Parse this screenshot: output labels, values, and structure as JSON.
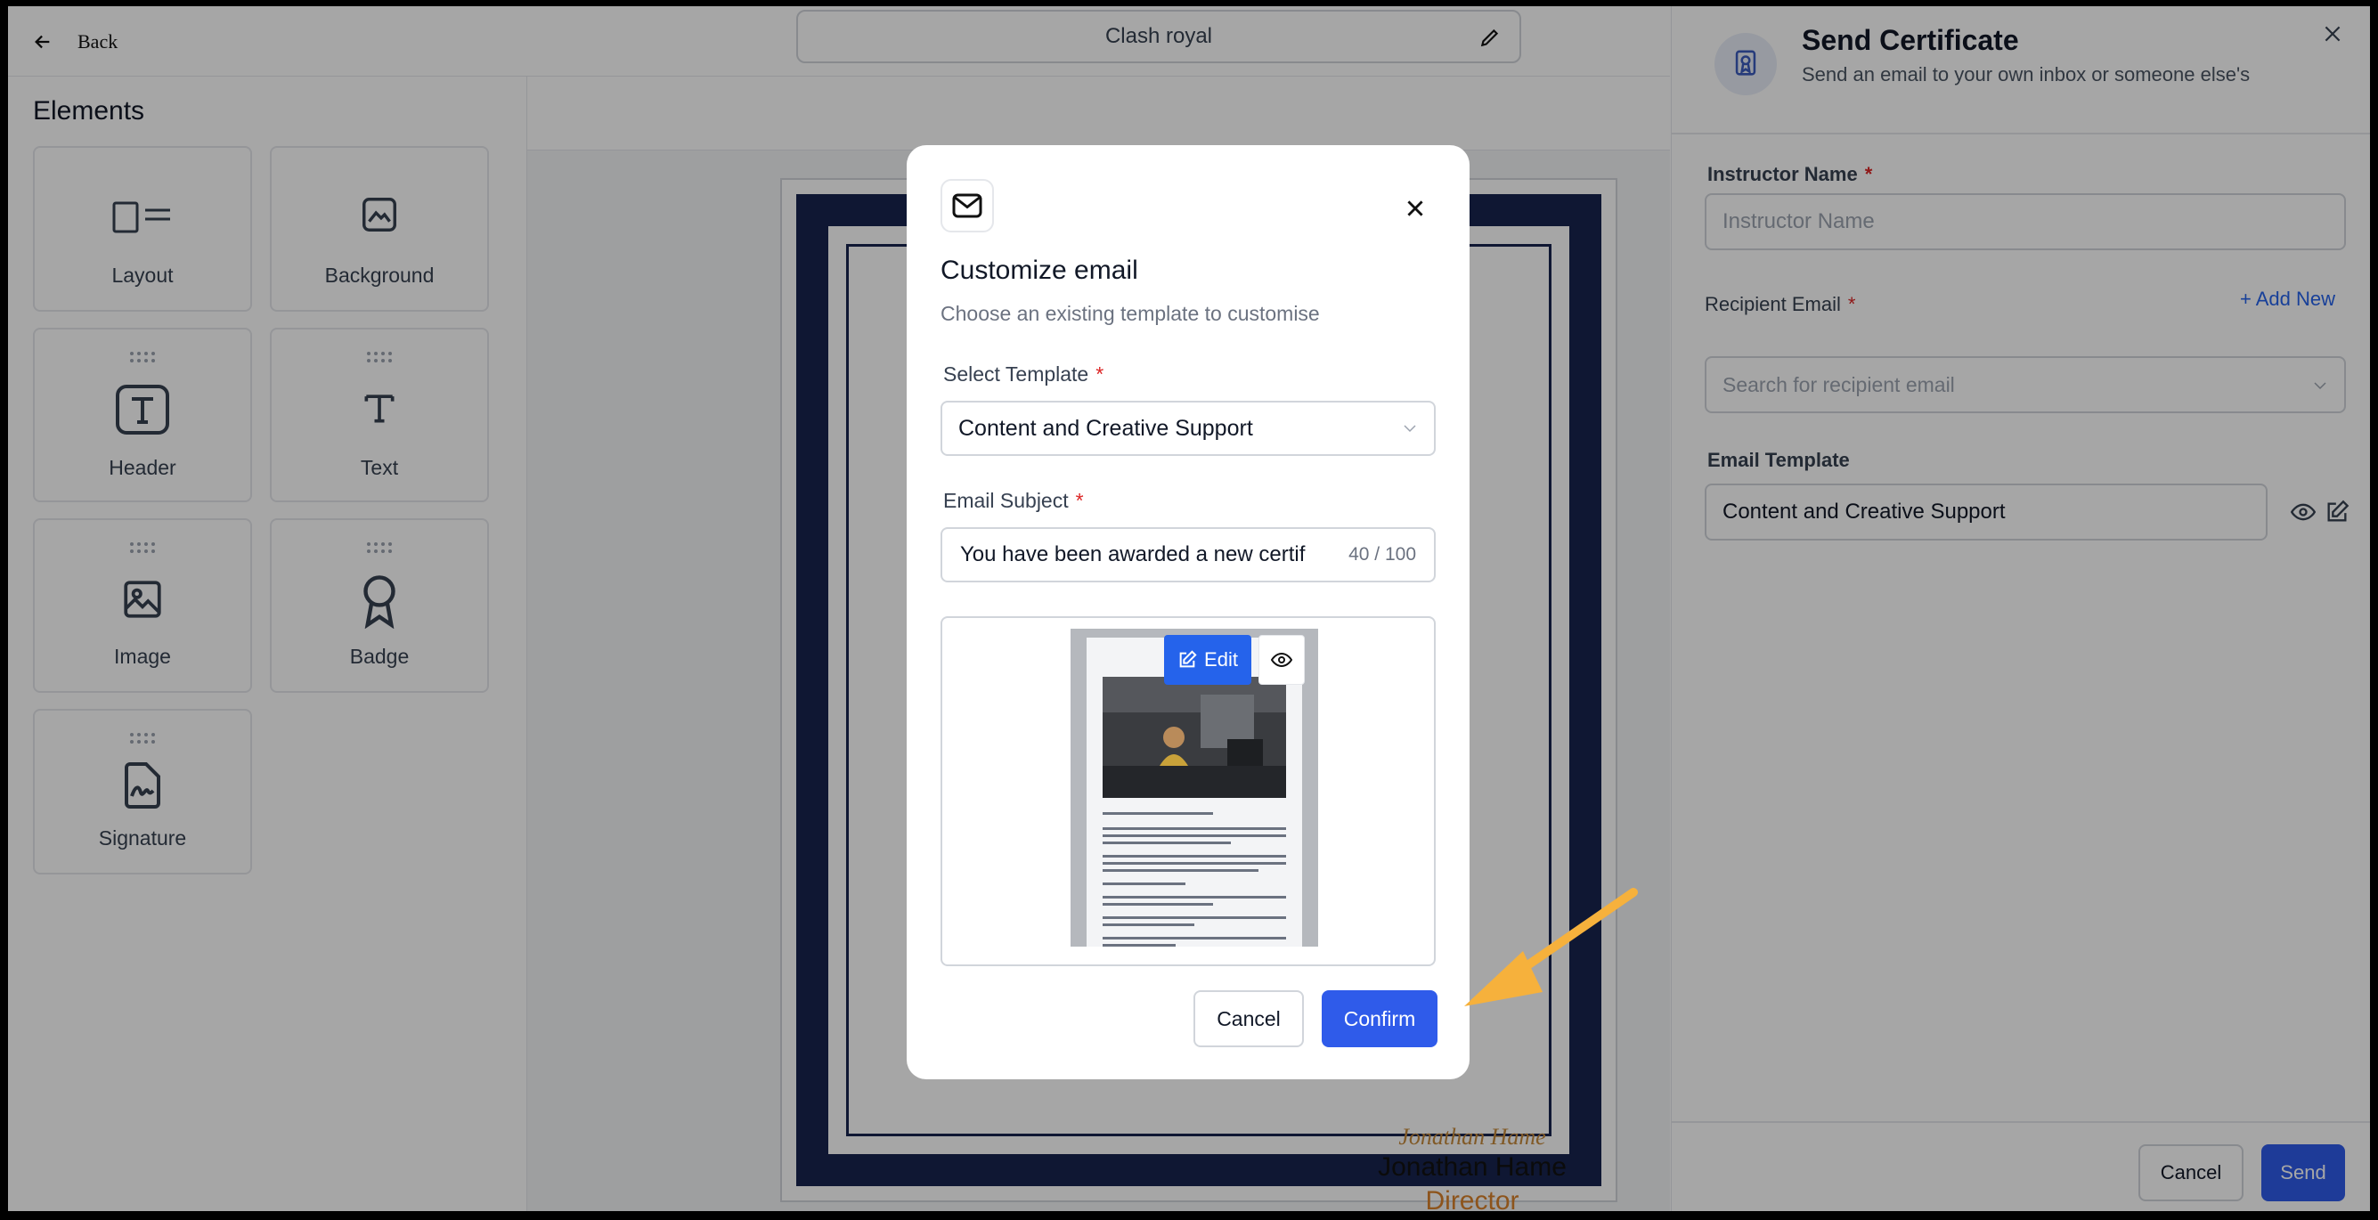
{
  "topbar": {
    "back_label": "Back",
    "document_title": "Clash royal"
  },
  "sidebar": {
    "heading": "Elements",
    "items": [
      {
        "label": "Layout",
        "icon": "layout-icon"
      },
      {
        "label": "Background",
        "icon": "image-frame-icon"
      },
      {
        "label": "Header",
        "icon": "header-t-icon"
      },
      {
        "label": "Text",
        "icon": "text-t-icon"
      },
      {
        "label": "Image",
        "icon": "image-icon"
      },
      {
        "label": "Badge",
        "icon": "badge-icon"
      },
      {
        "label": "Signature",
        "icon": "signature-icon"
      }
    ]
  },
  "certificate": {
    "signature_text": "Jonathan Hame",
    "signer_name": "Jonathan Hame",
    "signer_role": "Director",
    "border_color": "#17244f",
    "accent_color": "#d9822b"
  },
  "panel": {
    "title": "Send Certificate",
    "subtitle": "Send an email to your own inbox or someone else's",
    "instructor_label": "Instructor Name",
    "instructor_placeholder": "Instructor Name",
    "recipient_label": "Recipient Email",
    "add_new": "+ Add New",
    "recipient_placeholder": "Search for recipient email",
    "template_label": "Email Template",
    "template_value": "Content and Creative Support",
    "cancel": "Cancel",
    "send": "Send",
    "required_mark": "*"
  },
  "modal": {
    "title": "Customize email",
    "subtitle": "Choose an existing template to customise",
    "select_label": "Select Template",
    "select_value": "Content and Creative Support",
    "subject_label": "Email Subject",
    "subject_value": "You have been awarded a new certif",
    "subject_counter": "40 / 100",
    "edit_label": "Edit",
    "cancel": "Cancel",
    "confirm": "Confirm",
    "required_mark": "*"
  },
  "colors": {
    "primary": "#2f5bea",
    "link": "#2563eb",
    "arrow": "#f6b13c",
    "required": "#dc2626"
  }
}
